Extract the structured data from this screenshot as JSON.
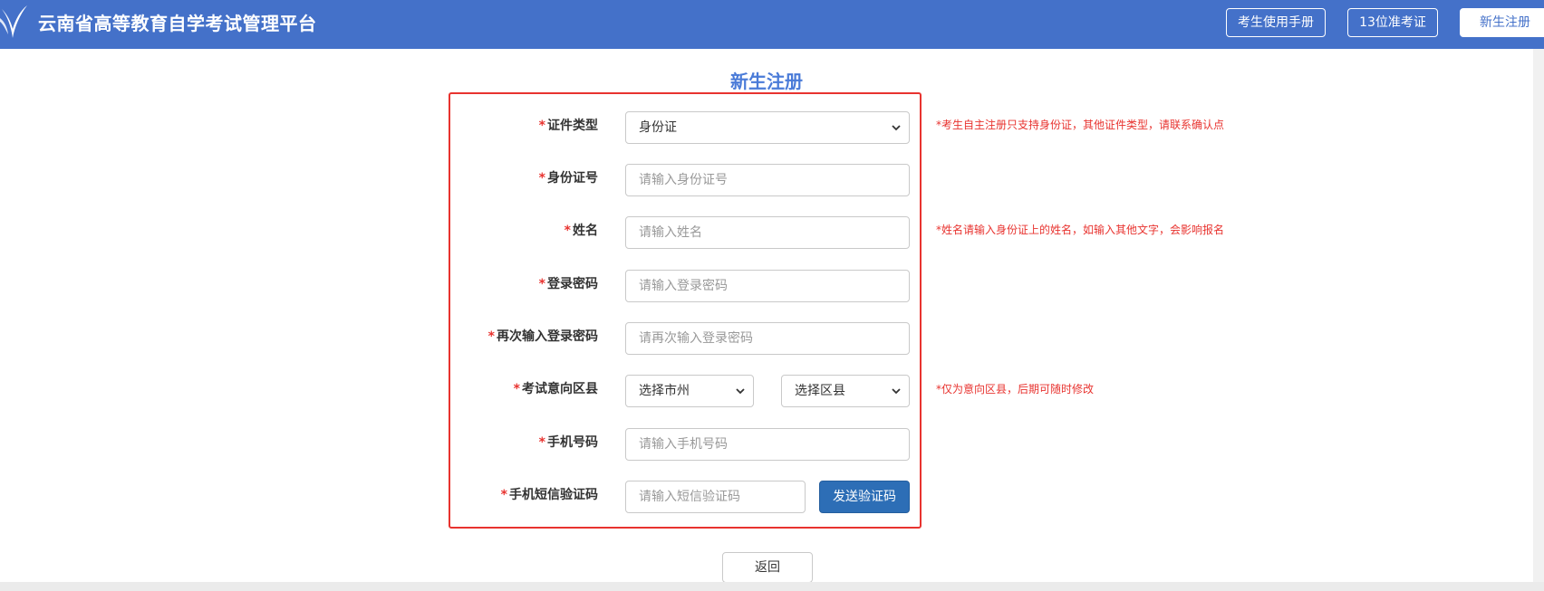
{
  "header": {
    "site_title": "云南省高等教育自学考试管理平台",
    "buttons": {
      "manual": "考生使用手册",
      "ticket": "13位准考证",
      "register": "新生注册"
    }
  },
  "page_title": "新生注册",
  "form": {
    "required_mark": "*",
    "id_type": {
      "label": "证件类型",
      "value": "身份证",
      "hint": "*考生自主注册只支持身份证，其他证件类型，请联系确认点"
    },
    "id_number": {
      "label": "身份证号",
      "placeholder": "请输入身份证号"
    },
    "name": {
      "label": "姓名",
      "placeholder": "请输入姓名",
      "hint": "*姓名请输入身份证上的姓名，如输入其他文字，会影响报名"
    },
    "password": {
      "label": "登录密码",
      "placeholder": "请输入登录密码"
    },
    "password_confirm": {
      "label": "再次输入登录密码",
      "placeholder": "请再次输入登录密码"
    },
    "region": {
      "label": "考试意向区县",
      "city_value": "选择市州",
      "county_value": "选择区县",
      "hint": "*仅为意向区县，后期可随时修改"
    },
    "phone": {
      "label": "手机号码",
      "placeholder": "请输入手机号码"
    },
    "sms_code": {
      "label": "手机短信验证码",
      "placeholder": "请输入短信验证码",
      "send_button": "发送验证码"
    }
  },
  "back_button": "返回",
  "colors": {
    "header_bg": "#4471c9",
    "accent": "#4a7bd8",
    "required": "#e8332f",
    "primary_button": "#2d6eb6"
  }
}
